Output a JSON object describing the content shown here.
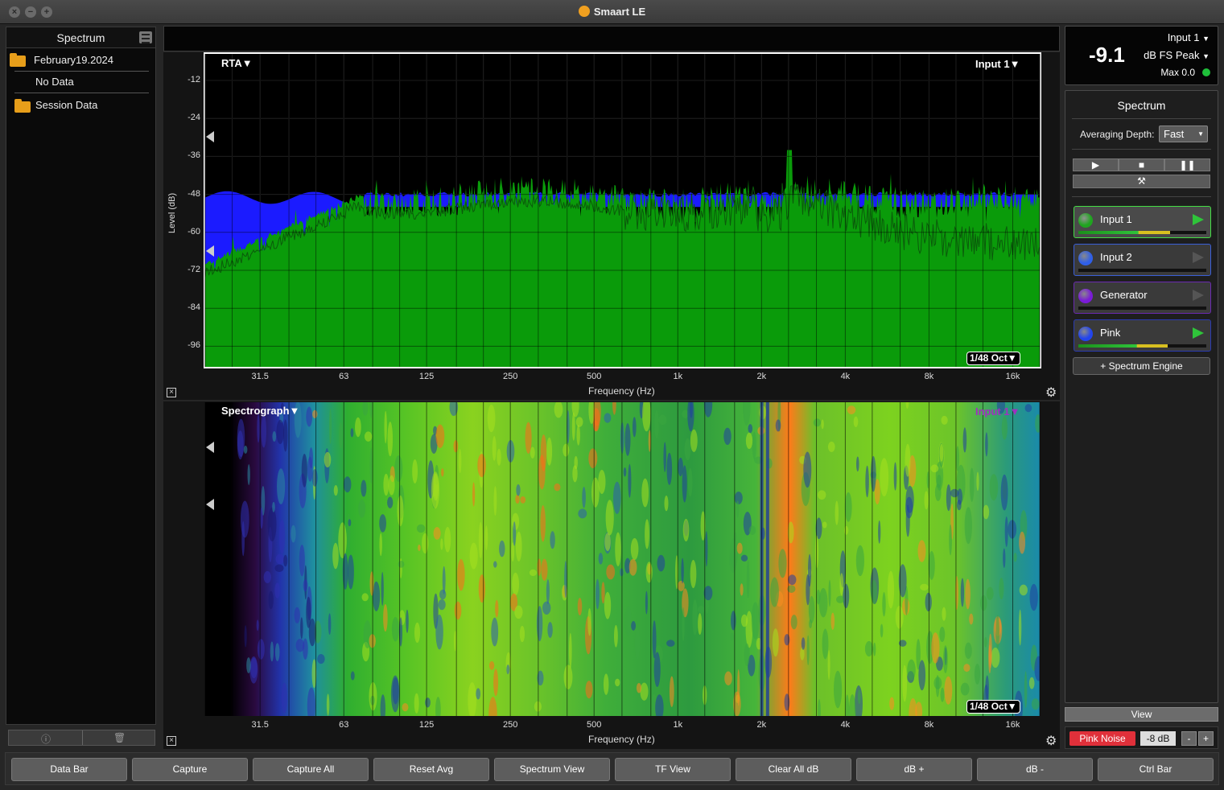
{
  "window": {
    "title": "Smaart LE"
  },
  "left_panel": {
    "title": "Spectrum",
    "items": [
      {
        "label": "February19.2024",
        "type": "folder"
      },
      {
        "label": "No Data",
        "type": "item"
      },
      {
        "label": "Session Data",
        "type": "folder"
      }
    ]
  },
  "rta": {
    "mode_label": "RTA▼",
    "source_label": "Input 1▼",
    "resolution_label": "1/48 Oct▼",
    "y_axis_label": "Level (dB)",
    "x_axis_label": "Frequency (Hz)",
    "y_ticks": [
      "-12",
      "-24",
      "-36",
      "-48",
      "-60",
      "-72",
      "-84",
      "-96"
    ],
    "x_ticks": [
      "31.5",
      "63",
      "125",
      "250",
      "500",
      "1k",
      "2k",
      "4k",
      "8k",
      "16k"
    ]
  },
  "spectrograph": {
    "mode_label": "Spectrograph▼",
    "source_label": "Input 1▼",
    "resolution_label": "1/48 Oct▼",
    "x_axis_label": "Frequency (Hz)",
    "x_ticks": [
      "31.5",
      "63",
      "125",
      "250",
      "500",
      "1k",
      "2k",
      "4k",
      "8k",
      "16k"
    ]
  },
  "meter": {
    "input_label": "Input 1",
    "value": "-9.1",
    "unit_label": "dB FS Peak",
    "max_label": "Max 0.0",
    "max_indicator_color": "#1fbf3a"
  },
  "control_panel": {
    "title": "Spectrum",
    "averaging_label": "Averaging Depth:",
    "averaging_value": "Fast",
    "sources": [
      {
        "name": "Input 1",
        "color": "#1fa51f",
        "border": "#44dd44",
        "active": true,
        "level": 0.72
      },
      {
        "name": "Input 2",
        "color": "#2f5fe8",
        "border": "#3a5fd8",
        "active": false,
        "level": 0
      },
      {
        "name": "Generator",
        "color": "#7a1ad8",
        "border": "#6a2ab0",
        "active": false,
        "level": 0
      },
      {
        "name": "Pink",
        "color": "#2244ee",
        "border": "#2a3ab0",
        "active": true,
        "level": 0.7
      }
    ],
    "add_engine_label": "+ Spectrum Engine"
  },
  "view_label": "View",
  "generator": {
    "button_label": "Pink Noise",
    "level_value": "-8 dB",
    "minus": "-",
    "plus": "+"
  },
  "bottom_bar": [
    "Data Bar",
    "Capture",
    "Capture All",
    "Reset Avg",
    "Spectrum View",
    "TF View",
    "Clear All dB",
    "dB +",
    "dB -",
    "Ctrl Bar"
  ],
  "colors": {
    "rta_fill": "#0a9b0a",
    "rta_ref": "#1b1bff",
    "accent_green": "#1fbf3a",
    "pink_noise": "#e0303a"
  }
}
